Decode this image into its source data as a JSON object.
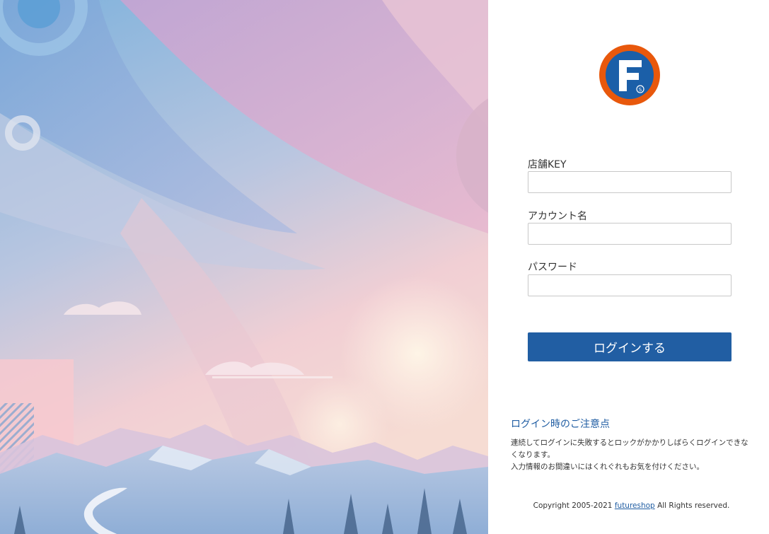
{
  "login": {
    "fields": [
      {
        "label": "店舗KEY",
        "value": ""
      },
      {
        "label": "アカウント名",
        "value": ""
      },
      {
        "label": "パスワード",
        "value": ""
      }
    ],
    "submit_label": "ログインする"
  },
  "notice": {
    "title": "ログイン時のご注意点",
    "lines": [
      "連続してログインに失敗するとロックがかかりしばらくログインできなくなります。",
      "入力情報のお間違いにはくれぐれもお気を付けください。"
    ]
  },
  "footer": {
    "prefix": "Copyright 2005-2021",
    "link": "futureshop",
    "suffix": "All Rights reserved."
  },
  "logo": {
    "letter": "F",
    "mark": "S",
    "ring_color": "#e8580c",
    "fill_color": "#1b5fa8"
  },
  "colors": {
    "accent": "#215ea3"
  }
}
